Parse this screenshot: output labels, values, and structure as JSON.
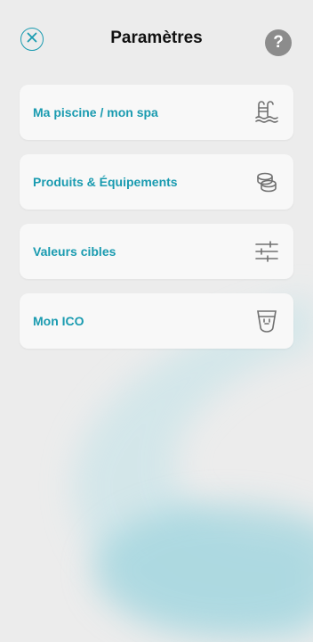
{
  "header": {
    "title": "Paramètres",
    "close_icon": "close-circle-icon",
    "help_icon": "question-mark-icon",
    "help_glyph": "?"
  },
  "menu": {
    "items": [
      {
        "label": "Ma piscine / mon spa",
        "icon": "pool-ladder-icon"
      },
      {
        "label": "Produits & Équipements",
        "icon": "product-stack-icon"
      },
      {
        "label": "Valeurs cibles",
        "icon": "sliders-icon"
      },
      {
        "label": "Mon ICO",
        "icon": "ico-device-icon"
      }
    ]
  },
  "colors": {
    "accent": "#1a9bb0",
    "background": "#ececec",
    "card": "#f8f8f8",
    "icon_gray": "#707070",
    "help_bg": "#8c8c8c"
  }
}
